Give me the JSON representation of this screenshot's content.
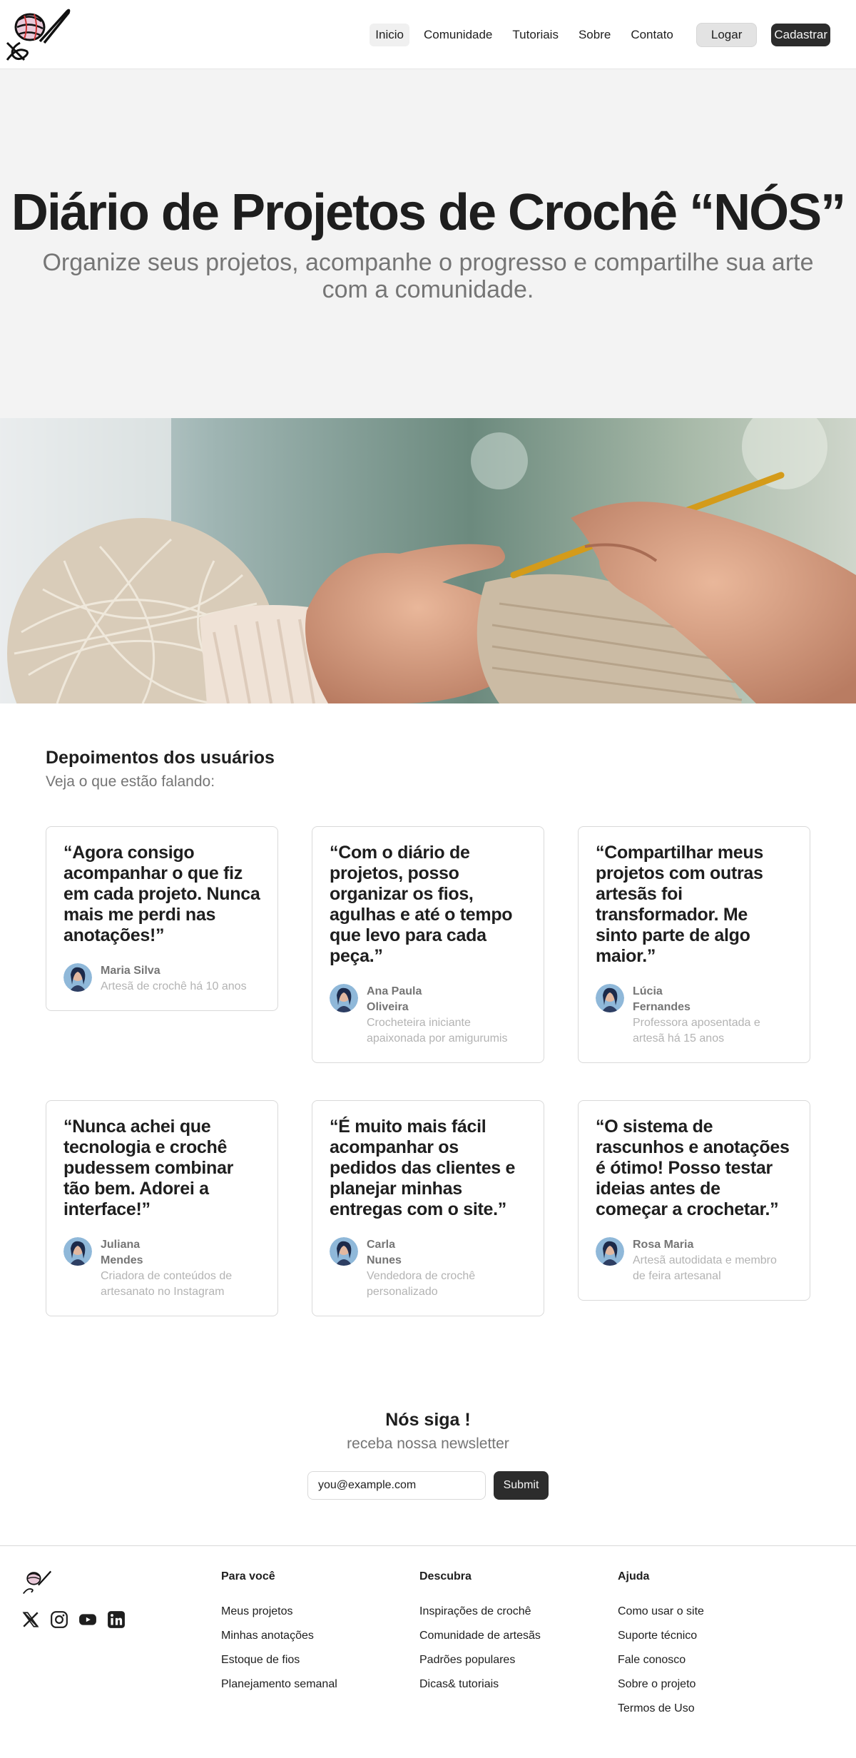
{
  "nav": {
    "links": [
      "Inicio",
      "Comunidade",
      "Tutoriais",
      "Sobre",
      "Contato"
    ],
    "login_label": "Logar",
    "signup_label": "Cadastrar"
  },
  "hero": {
    "title": "Diário de Projetos de Crochê “NÓS”",
    "subtitle": "Organize seus projetos, acompanhe o progresso e compartilhe sua arte com a comunidade."
  },
  "testimonials": {
    "title": "Depoimentos dos usuários",
    "subtitle": "Veja o que estão falando:",
    "items": [
      {
        "quote": "“Agora consigo acompanhar o que fiz em cada projeto. Nunca mais me perdi nas anotações!”",
        "name": "Maria Silva",
        "desc": "Artesã de crochê há 10 anos"
      },
      {
        "quote": "“Com o diário de projetos, posso organizar os fios, agulhas e até o tempo que levo para cada peça.”",
        "name": "Ana Paula Oliveira",
        "desc": "Crocheteira iniciante apaixonada por amigurumis"
      },
      {
        "quote": "“Compartilhar meus projetos com outras artesãs foi transformador. Me sinto parte de algo maior.”",
        "name": "Lúcia Fernandes",
        "desc": "Professora aposentada e artesã há 15 anos"
      },
      {
        "quote": "“Nunca achei que tecnologia e crochê pudessem combinar tão bem. Adorei a interface!”",
        "name": "Juliana Mendes",
        "desc": "Criadora de conteúdos de artesanato no Instagram"
      },
      {
        "quote": "“É muito mais fácil acompanhar os pedidos das clientes e planejar minhas entregas com o site.”",
        "name": "Carla Nunes",
        "desc": "Vendedora de crochê personalizado"
      },
      {
        "quote": "“O sistema de rascunhos e anotações é ótimo! Posso testar ideias antes de começar a crochetar.”",
        "name": "Rosa Maria",
        "desc": "Artesã autodidata e membro de feira artesanal"
      }
    ]
  },
  "newsletter": {
    "title": "Nós siga !",
    "subtitle": "receba nossa newsletter",
    "input_value": "you@example.com",
    "submit_label": "Submit"
  },
  "footer": {
    "socials": [
      "x-icon",
      "instagram-icon",
      "youtube-icon",
      "linkedin-icon"
    ],
    "columns": [
      {
        "title": "Para você",
        "items": [
          "Meus projetos",
          "Minhas anotações",
          "Estoque de fios",
          "Planejamento semanal"
        ]
      },
      {
        "title": "Descubra",
        "items": [
          "Inspirações de crochê",
          "Comunidade de artesãs",
          "Padrões populares",
          "Dicas& tutoriais"
        ]
      },
      {
        "title": "Ajuda",
        "items": [
          "Como usar o site",
          "Suporte técnico",
          "Fale conosco",
          "Sobre o projeto",
          "Termos de Uso"
        ]
      }
    ]
  }
}
